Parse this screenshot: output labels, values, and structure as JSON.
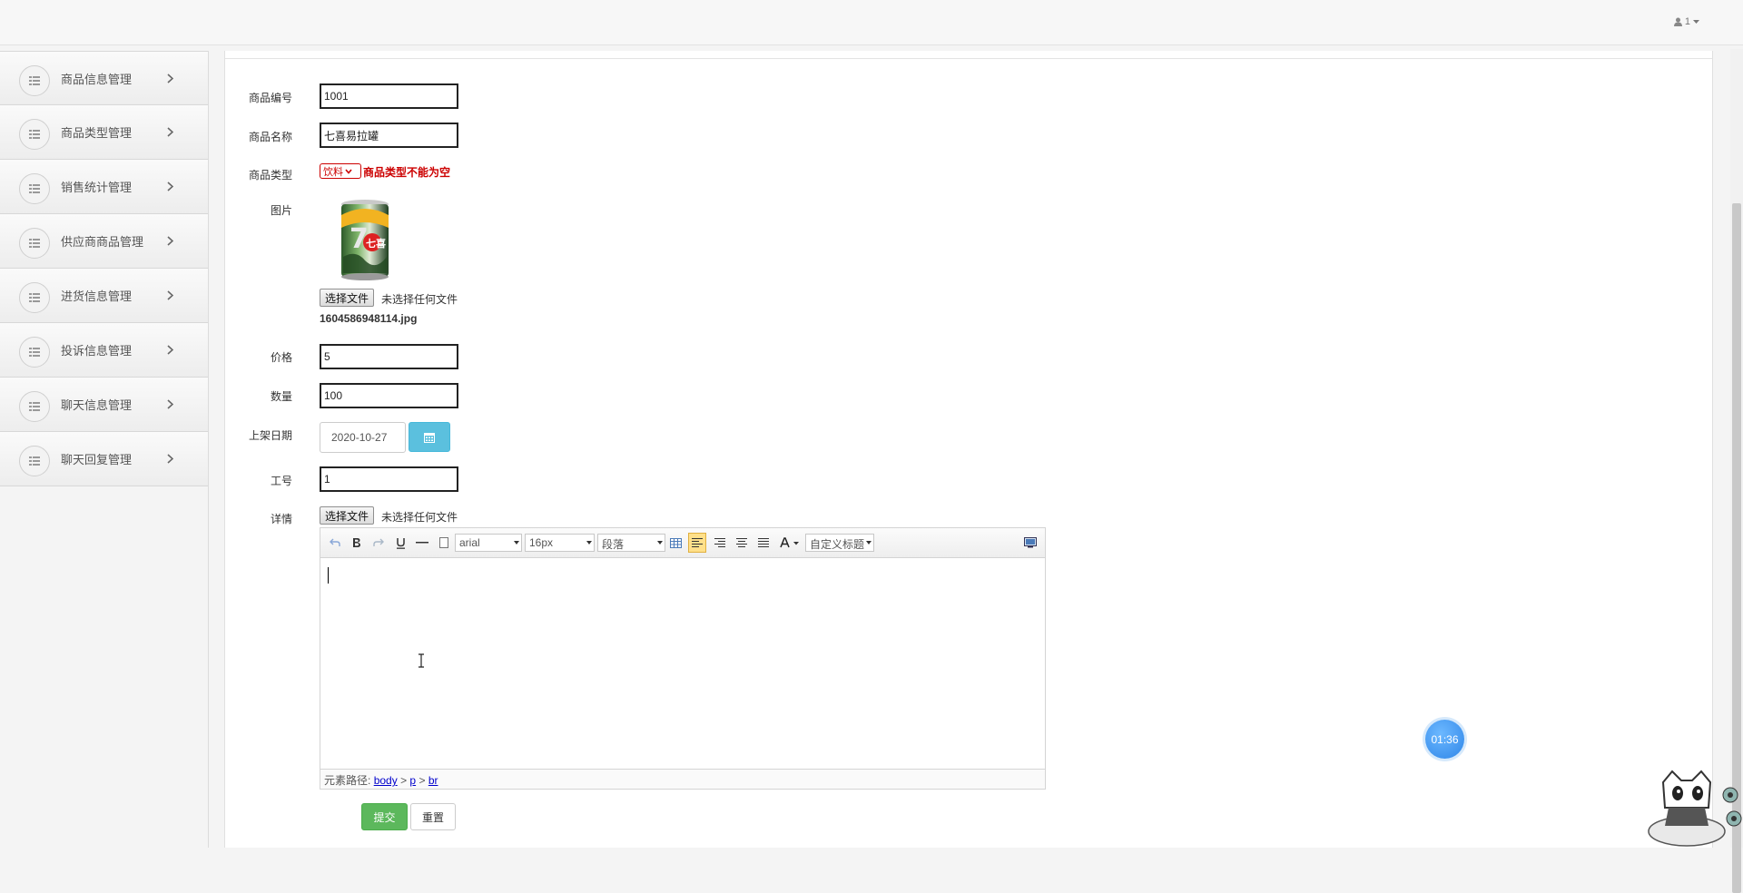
{
  "header": {
    "user_label": "1"
  },
  "sidebar": {
    "items": [
      {
        "label": "商品信息管理"
      },
      {
        "label": "商品类型管理"
      },
      {
        "label": "销售统计管理"
      },
      {
        "label": "供应商商品管理"
      },
      {
        "label": "进货信息管理"
      },
      {
        "label": "投诉信息管理"
      },
      {
        "label": "聊天信息管理"
      },
      {
        "label": "聊天回复管理"
      }
    ]
  },
  "form": {
    "code": {
      "label": "商品编号",
      "value": "1001"
    },
    "name": {
      "label": "商品名称",
      "value": "七喜易拉罐"
    },
    "type": {
      "label": "商品类型",
      "selected": "饮料",
      "error": "商品类型不能为空"
    },
    "image": {
      "label": "图片",
      "file_button": "选择文件",
      "no_file": "未选择任何文件",
      "filename": "1604586948114.jpg",
      "brand_text": "七喜"
    },
    "price": {
      "label": "价格",
      "value": "5"
    },
    "quantity": {
      "label": "数量",
      "value": "100"
    },
    "listing_date": {
      "label": "上架日期",
      "value": "2020-10-27"
    },
    "staff_no": {
      "label": "工号",
      "value": "1"
    },
    "details": {
      "label": "详情",
      "file_button": "选择文件",
      "no_file": "未选择任何文件"
    },
    "submit_label": "提交",
    "reset_label": "重置"
  },
  "editor": {
    "font_family": "arial",
    "font_size": "16px",
    "paragraph": "段落",
    "custom_title": "自定义标题",
    "status_prefix": "元素路径:",
    "path": [
      "body",
      "p",
      "br"
    ],
    "path_sep": ">"
  },
  "timer": {
    "value": "01:36"
  },
  "colors": {
    "error": "#cc0000",
    "submit": "#5cb85c",
    "calendar": "#5bc0de",
    "timer": "#3a8ff0"
  }
}
